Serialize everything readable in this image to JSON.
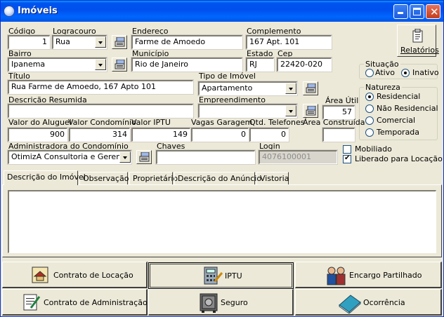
{
  "window": {
    "title": "Imóveis"
  },
  "labels": {
    "codigo": "Código",
    "logradouro": "Logracouro",
    "endereco": "Endereço",
    "complemento": "Complemento",
    "bairro": "Bairro",
    "municipio": "Município",
    "estado": "Estado",
    "cep": "Cep",
    "titulo": "Título",
    "tipo_imovel": "Tipo de Imóvel",
    "descricao_resumida": "Descrição Resumida",
    "empreendimento": "Empreendimento",
    "area_util": "Área Útil",
    "valor_aluguel": "Valor do Aluguel",
    "valor_condominio": "Valor Condomínio",
    "valor_iptu": "Valor IPTU",
    "vagas_garagem": "Vagas Garagem",
    "qtd_telefones": "Qtd. Telefones",
    "area_construida": "Área Construída",
    "administradora": "Administradora do Condomínio",
    "chaves": "Chaves",
    "login": "Login"
  },
  "fields": {
    "codigo": "1",
    "logradouro": "Rua",
    "endereco": "Farme de Amoedo",
    "complemento": "167 Apt. 101",
    "bairro": "Ipanema",
    "municipio": "Rio de Janeiro",
    "estado": "RJ",
    "cep": "22420-020",
    "titulo": "Rua Farme de Amoedo, 167 Apto 101",
    "tipo_imovel": "Apartamento",
    "descricao_resumida": "",
    "empreendimento": "",
    "area_util": "57",
    "valor_aluguel": "900",
    "valor_condominio": "314",
    "valor_iptu": "149",
    "vagas_garagem": "0",
    "qtd_telefones": "0",
    "area_construida": "",
    "administradora": "OtimizA Consultoria e Gerenc. Se",
    "chaves": "",
    "login": "4076100001"
  },
  "relatorios": {
    "label": "Relatórios"
  },
  "situacao": {
    "title": "Situação",
    "options": [
      "Ativo",
      "Inativo"
    ],
    "selected": "Inativo"
  },
  "natureza": {
    "title": "Natureza",
    "options": [
      "Residencial",
      "Não Residencial",
      "Comercial",
      "Temporada"
    ],
    "selected": "Residencial"
  },
  "checks": {
    "mobiliado": "Mobiliado",
    "liberado": "Liberado para Locação"
  },
  "tabs": [
    "Descrição do Imóvel",
    "Observação",
    "Proprietário",
    "Descrição do Anúncio",
    "Vistoria"
  ],
  "buttons": {
    "contrato_locacao": "Contrato de Locação",
    "iptu": "IPTU",
    "encargo": "Encargo Partilhado",
    "contrato_admin": "Contrato de Administração",
    "seguro": "Seguro",
    "ocorrencia": "Ocorrência"
  }
}
